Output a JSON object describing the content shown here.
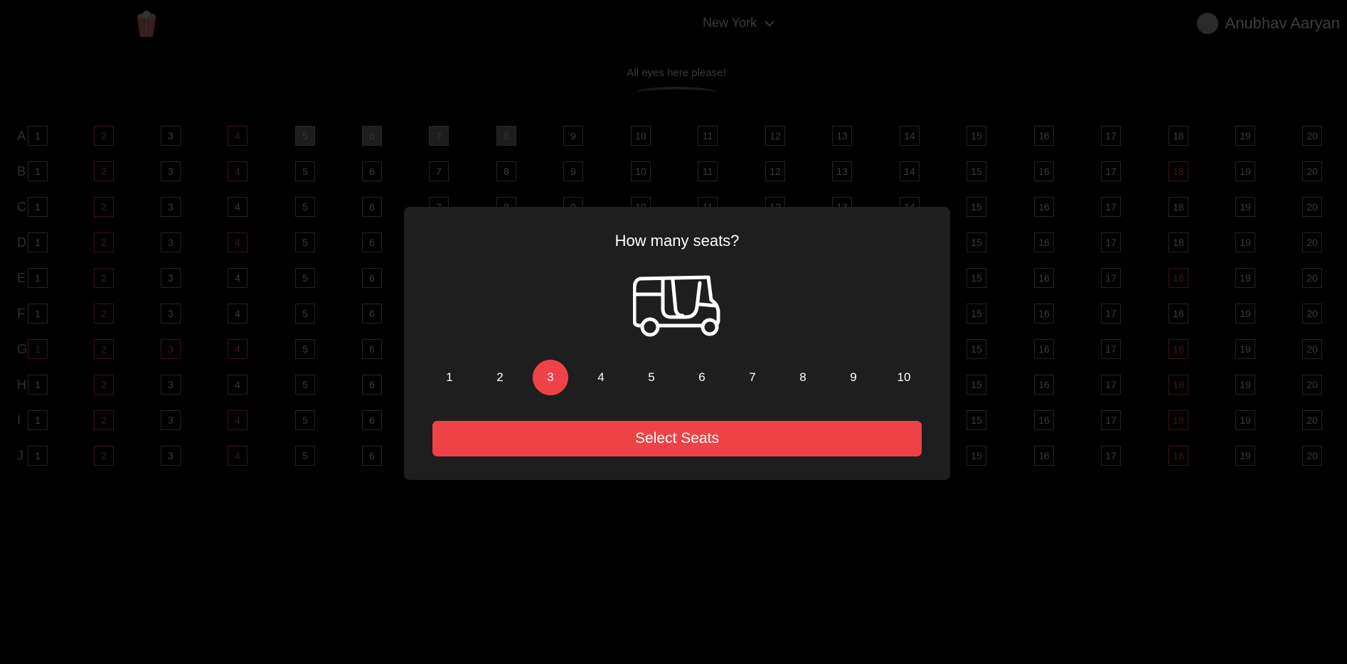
{
  "header": {
    "logo_icon": "popcorn-icon",
    "city": "New York",
    "city_icon": "chevron-down-icon",
    "user_name": "Anubhav Aaryan"
  },
  "screen": {
    "label": "All eyes here please!"
  },
  "seating": {
    "rows": [
      "A",
      "B",
      "C",
      "D",
      "E",
      "F",
      "G",
      "H",
      "I",
      "J"
    ],
    "seat_numbers": [
      1,
      2,
      3,
      4,
      5,
      6,
      7,
      8,
      9,
      10,
      11,
      12,
      13,
      14,
      15,
      16,
      17,
      18,
      19,
      20
    ],
    "booked_seats": [
      "A5",
      "A6",
      "A7",
      "A8"
    ]
  },
  "modal": {
    "title": "How many seats?",
    "illustration": "auto-rickshaw-icon",
    "counts": [
      "1",
      "2",
      "3",
      "4",
      "5",
      "6",
      "7",
      "8",
      "9",
      "10"
    ],
    "selected_count": "3",
    "button_label": "Select Seats"
  },
  "colors": {
    "accent": "#ef4247",
    "modal_bg": "#1e1e1e",
    "page_bg": "#000000"
  }
}
